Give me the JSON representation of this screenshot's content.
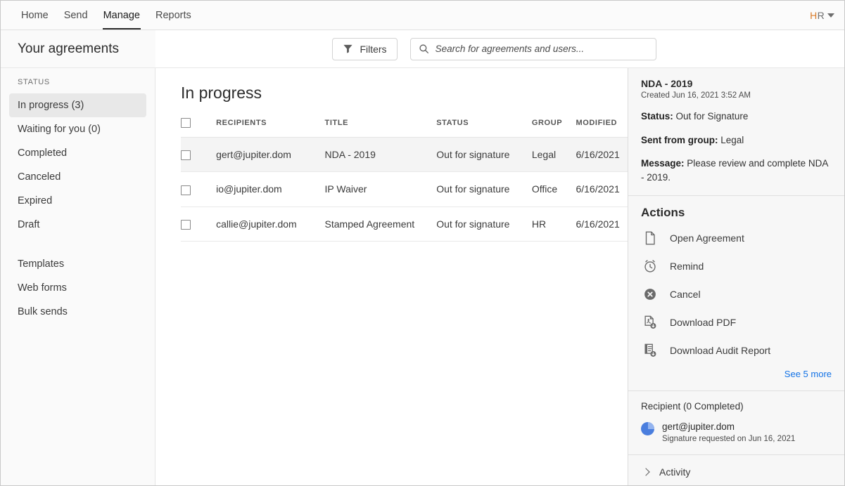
{
  "topnav": {
    "items": [
      {
        "label": "Home",
        "active": false
      },
      {
        "label": "Send",
        "active": false
      },
      {
        "label": "Manage",
        "active": true
      },
      {
        "label": "Reports",
        "active": false
      }
    ],
    "account": {
      "initial_1": "H",
      "initial_2": "R"
    }
  },
  "header": {
    "page_title": "Your agreements",
    "filters_label": "Filters",
    "search_placeholder": "Search for agreements and users...",
    "search_value": ""
  },
  "sidebar": {
    "group_label": "STATUS",
    "items": [
      {
        "label": "In progress (3)",
        "selected": true
      },
      {
        "label": "Waiting for you (0)",
        "selected": false
      },
      {
        "label": "Completed",
        "selected": false
      },
      {
        "label": "Canceled",
        "selected": false
      },
      {
        "label": "Expired",
        "selected": false
      },
      {
        "label": "Draft",
        "selected": false
      }
    ],
    "items2": [
      {
        "label": "Templates"
      },
      {
        "label": "Web forms"
      },
      {
        "label": "Bulk sends"
      }
    ]
  },
  "main": {
    "title": "In progress",
    "columns": [
      "RECIPIENTS",
      "TITLE",
      "STATUS",
      "GROUP",
      "MODIFIED"
    ],
    "rows": [
      {
        "recipient": "gert@jupiter.dom",
        "title": "NDA - 2019",
        "status": "Out for signature",
        "group": "Legal",
        "modified": "6/16/2021",
        "selected": true
      },
      {
        "recipient": "io@jupiter.dom",
        "title": "IP Waiver",
        "status": "Out for signature",
        "group": "Office",
        "modified": "6/16/2021",
        "selected": false
      },
      {
        "recipient": "callie@jupiter.dom",
        "title": "Stamped Agreement",
        "status": "Out for signature",
        "group": "HR",
        "modified": "6/16/2021",
        "selected": false
      }
    ]
  },
  "details": {
    "doc_title": "NDA - 2019",
    "created": "Created Jun 16, 2021 3:52 AM",
    "status_label": "Status:",
    "status_value": "Out for Signature",
    "group_label": "Sent from group:",
    "group_value": "Legal",
    "message_label": "Message:",
    "message_value": "Please review and complete NDA - 2019.",
    "actions_heading": "Actions",
    "actions": [
      {
        "label": "Open Agreement",
        "icon": "document-icon"
      },
      {
        "label": "Remind",
        "icon": "alarm-clock-icon"
      },
      {
        "label": "Cancel",
        "icon": "cancel-circle-icon"
      },
      {
        "label": "Download PDF",
        "icon": "download-pdf-icon"
      },
      {
        "label": "Download Audit Report",
        "icon": "download-audit-icon"
      }
    ],
    "see_more": "See 5 more",
    "recipient_heading": "Recipient (0 Completed)",
    "recipient_email": "gert@jupiter.dom",
    "recipient_sub": "Signature requested on Jun 16, 2021",
    "activity_label": "Activity"
  },
  "colors": {
    "accent_link": "#1473e6",
    "avatar": "#4a7ede",
    "brand_orange": "#d97c2b",
    "selected_row": "#f4f4f4"
  }
}
